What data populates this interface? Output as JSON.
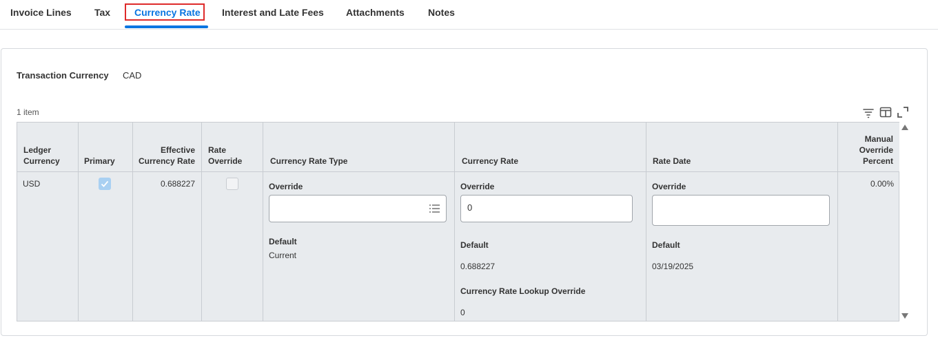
{
  "tabs": [
    {
      "label": "Invoice Lines"
    },
    {
      "label": "Tax"
    },
    {
      "label": "Currency Rate",
      "active": true
    },
    {
      "label": "Interest and Late Fees"
    },
    {
      "label": "Attachments"
    },
    {
      "label": "Notes"
    }
  ],
  "transaction_currency": {
    "label": "Transaction Currency",
    "value": "CAD"
  },
  "grid": {
    "count": "1 item",
    "columns": {
      "ledger_currency": [
        "Ledger",
        "Currency"
      ],
      "primary": "Primary",
      "effective_rate": [
        "Effective",
        "Currency Rate"
      ],
      "rate_override": [
        "Rate",
        "Override"
      ],
      "currency_rate_type": "Currency Rate Type",
      "currency_rate": "Currency Rate",
      "rate_date": "Rate Date",
      "manual_override_percent": [
        "Manual",
        "Override",
        "Percent"
      ]
    },
    "row": {
      "ledger_currency": "USD",
      "primary_checked": true,
      "effective_rate": "0.688227",
      "rate_override_checked": false,
      "rate_type": {
        "override_label": "Override",
        "override_value": "",
        "default_label": "Default",
        "default_value": "Current"
      },
      "currency_rate": {
        "override_label": "Override",
        "override_value": "0",
        "default_label": "Default",
        "default_value": "0.688227",
        "lookup_label": "Currency Rate Lookup Override",
        "lookup_value": "0"
      },
      "rate_date": {
        "override_label": "Override",
        "override_value": "",
        "default_label": "Default",
        "default_value": "03/19/2025"
      },
      "manual_override_percent": "0.00%"
    }
  },
  "icons": {
    "filter": "filter-icon",
    "columns": "columns-icon",
    "expand": "expand-icon",
    "prompt": "list-prompt-icon"
  },
  "colors": {
    "accent": "#0875e1",
    "highlight": "#de2a2a"
  }
}
